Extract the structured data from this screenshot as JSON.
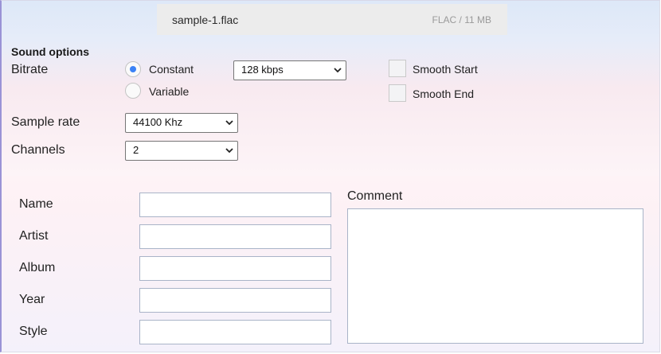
{
  "file": {
    "name": "sample-1.flac",
    "info": "FLAC / 11 MB"
  },
  "sound_options": {
    "title": "Sound options",
    "bitrate": {
      "label": "Bitrate",
      "modes": [
        {
          "label": "Constant",
          "selected": true
        },
        {
          "label": "Variable",
          "selected": false
        }
      ],
      "value": "128 kbps"
    },
    "smooth_start": {
      "label": "Smooth Start",
      "checked": false
    },
    "smooth_end": {
      "label": "Smooth End",
      "checked": false
    },
    "sample_rate": {
      "label": "Sample rate",
      "value": "44100 Khz"
    },
    "channels": {
      "label": "Channels",
      "value": "2"
    }
  },
  "metadata": {
    "fields": [
      {
        "label": "Name",
        "value": ""
      },
      {
        "label": "Artist",
        "value": ""
      },
      {
        "label": "Album",
        "value": ""
      },
      {
        "label": "Year",
        "value": ""
      },
      {
        "label": "Style",
        "value": ""
      }
    ],
    "comment_label": "Comment",
    "comment_value": ""
  },
  "colors": {
    "radio_selected": "#3b82f6",
    "left_border": "#9a93d6"
  }
}
